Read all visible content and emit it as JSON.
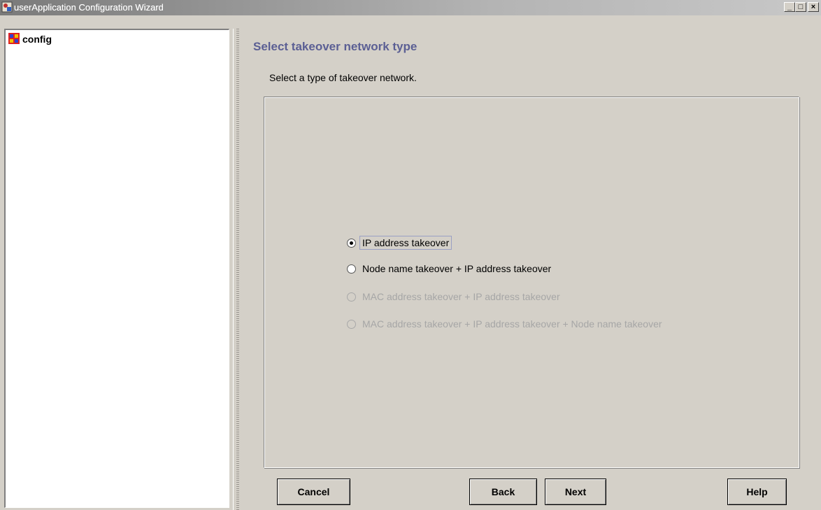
{
  "window": {
    "title": "userApplication Configuration Wizard",
    "icon": "wizard-app-icon",
    "controls": {
      "minimize": "_",
      "maximize": "□",
      "close": "×"
    }
  },
  "tree": {
    "root": {
      "label": "config",
      "icon": "config-node-icon"
    }
  },
  "page": {
    "heading": "Select takeover network type",
    "instruction": "Select a type of takeover network."
  },
  "options": [
    {
      "label": "IP address takeover",
      "selected": true,
      "enabled": true
    },
    {
      "label": "Node name takeover + IP address takeover",
      "selected": false,
      "enabled": true
    },
    {
      "label": "MAC address takeover + IP address takeover",
      "selected": false,
      "enabled": false
    },
    {
      "label": "MAC address takeover + IP address takeover + Node name takeover",
      "selected": false,
      "enabled": false
    }
  ],
  "buttons": {
    "cancel": "Cancel",
    "back": "Back",
    "next": "Next",
    "help": "Help"
  },
  "colors": {
    "heading": "#5b5f94",
    "background": "#d4d0c8",
    "disabled_text": "#a6a6a6"
  }
}
